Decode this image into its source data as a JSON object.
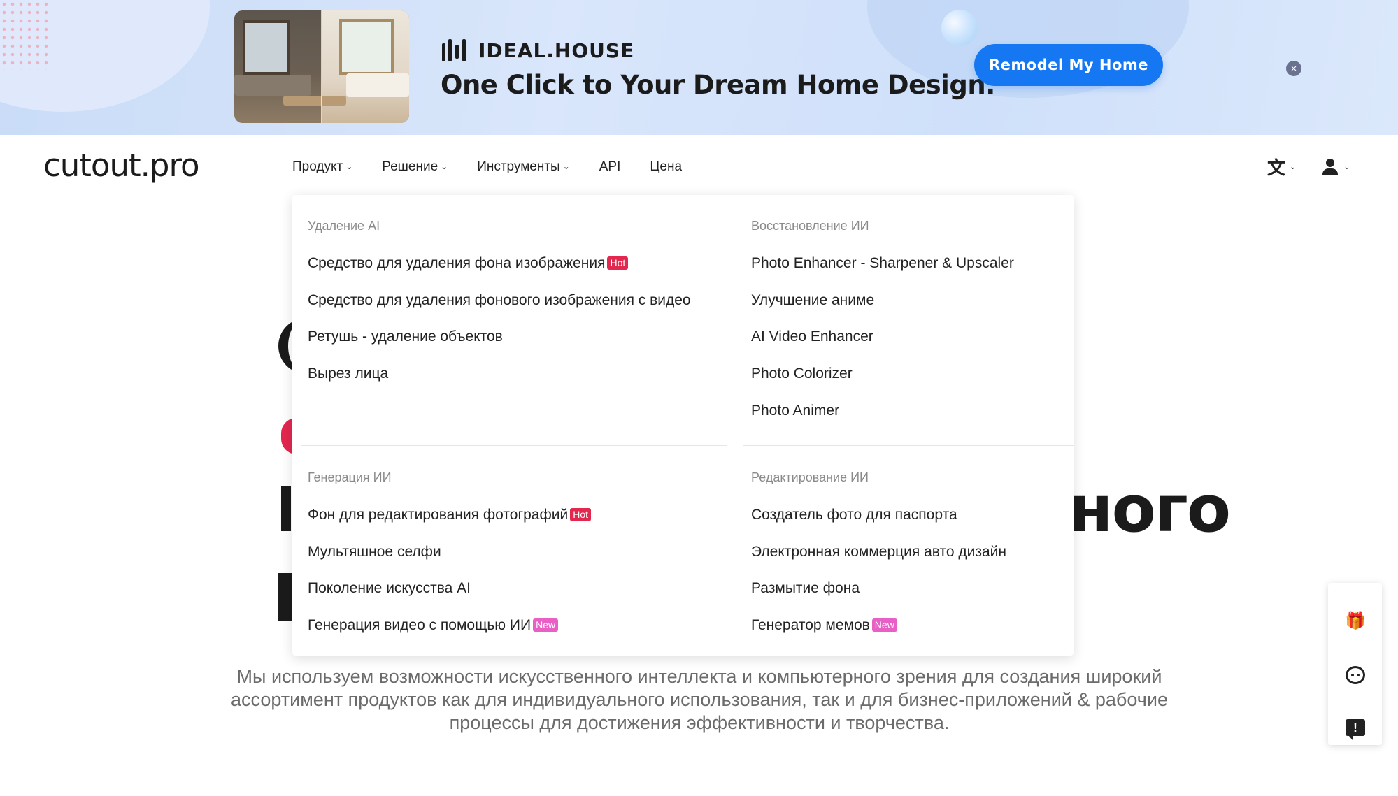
{
  "banner": {
    "brand": "IDEAL.HOUSE",
    "tagline": "One Click to Your Dream Home Design.",
    "cta": "Remodel My Home",
    "close": "×"
  },
  "header": {
    "logo": "cutout.pro",
    "nav": [
      {
        "label": "Продукт",
        "has_menu": true
      },
      {
        "label": "Решение",
        "has_menu": true
      },
      {
        "label": "Инструменты",
        "has_menu": true
      },
      {
        "label": "API",
        "has_menu": false
      },
      {
        "label": "Цена",
        "has_menu": false
      }
    ],
    "lang_icon": "translate-icon",
    "user_icon": "user-icon"
  },
  "dropdown": {
    "sections": [
      {
        "title": "Удаление AI",
        "items": [
          {
            "label": "Средство для удаления фона изображения",
            "badge": "Hot"
          },
          {
            "label": "Средство для удаления фонового изображения с видео",
            "badge": ""
          },
          {
            "label": "Ретушь - удаление объектов",
            "badge": ""
          },
          {
            "label": "Вырез лица",
            "badge": ""
          }
        ]
      },
      {
        "title": "Восстановление ИИ",
        "items": [
          {
            "label": "Photo Enhancer - Sharpener & Upscaler",
            "badge": ""
          },
          {
            "label": "Улучшение аниме",
            "badge": ""
          },
          {
            "label": "AI Video Enhancer",
            "badge": ""
          },
          {
            "label": "Photo Colorizer",
            "badge": ""
          },
          {
            "label": "Photo Animer",
            "badge": ""
          }
        ]
      },
      {
        "title": "Генерация ИИ",
        "items": [
          {
            "label": "Фон для редактирования фотографий",
            "badge": "Hot"
          },
          {
            "label": "Мультяшное селфи",
            "badge": ""
          },
          {
            "label": "Поколение искусства AI",
            "badge": ""
          },
          {
            "label": "Генерация видео с помощью ИИ",
            "badge": "New"
          }
        ]
      },
      {
        "title": "Редактирование ИИ",
        "items": [
          {
            "label": "Создатель фото для паспорта",
            "badge": ""
          },
          {
            "label": "Электронная коммерция авто дизайн",
            "badge": ""
          },
          {
            "label": "Размытие фона",
            "badge": ""
          },
          {
            "label": "Генератор мемов",
            "badge": "New"
          }
        ]
      }
    ]
  },
  "hero": {
    "title_fragment": "ного",
    "description": "Мы используем возможности искусственного интеллекта и компьютерного зрения для создания широкий ассортимент продуктов как для индивидуального использования, так и для бизнес-приложений & рабочие процессы для достижения эффективности и творчества."
  },
  "floatbar": {
    "items": [
      "gift-icon",
      "chatbot-icon",
      "feedback-icon"
    ]
  },
  "colors": {
    "cta": "#1677f2",
    "hot_badge": "#e3284f",
    "new_badge": "#e860c5",
    "accent_red": "#e3284f"
  }
}
